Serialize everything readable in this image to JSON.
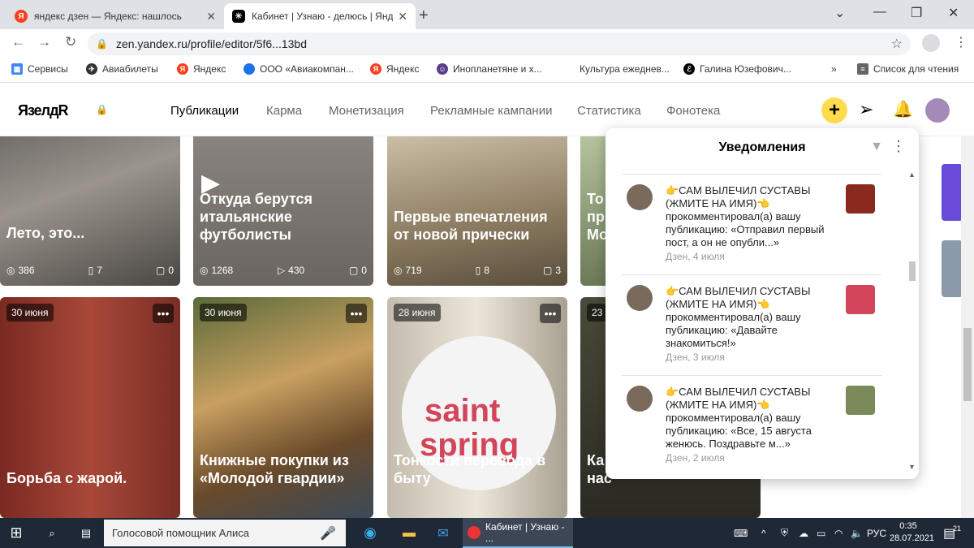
{
  "browser": {
    "tabs": [
      {
        "title": "яндекс дзен — Яндекс: нашлось",
        "favicon": "yandex-icon",
        "active": false
      },
      {
        "title": "Кабинет | Узнаю - делюсь | Янд",
        "favicon": "dzen-icon",
        "active": true
      }
    ],
    "new_tab": "+",
    "url": "zen.yandex.ru/profile/editor/5f6...13bd",
    "bookmarks": [
      {
        "label": "Сервисы",
        "icon": "apps-grid-icon",
        "color": "#4285f4"
      },
      {
        "label": "Авиабилеты",
        "icon": "airplane-icon",
        "color": "#333333"
      },
      {
        "label": "Яндекс",
        "icon": "yandex-icon",
        "color": "#fc3f1d"
      },
      {
        "label": "ООО «Авиакомпан...",
        "icon": "circle-icon",
        "color": "#1a73e8"
      },
      {
        "label": "Яндекс",
        "icon": "yandex-icon",
        "color": "#fc3f1d"
      },
      {
        "label": "Инопланетяне и х...",
        "icon": "person-icon",
        "color": "#5b3e8a"
      },
      {
        "label": "Культура ежеднев...",
        "icon": "none",
        "color": "#ffffff"
      },
      {
        "label": "Галина Юзефович...",
        "icon": "script-e-icon",
        "color": "#000000"
      }
    ],
    "bookmarks_overflow": "»",
    "reading_list": "Список для чтения"
  },
  "header": {
    "logo": "ЯзелдR",
    "nav": [
      "Публикации",
      "Карма",
      "Монетизация",
      "Рекламные кампании",
      "Статистика",
      "Фонотека"
    ],
    "active_nav": "Публикации",
    "accent_color": "#ffdb4d"
  },
  "cards_top": [
    {
      "title": "Лето, это...",
      "views": "386",
      "reads": "7",
      "comments": "0"
    },
    {
      "title": "Откуда берутся итальянские футболисты",
      "views": "1268",
      "plays": "430",
      "comments": "0"
    },
    {
      "title": "Первые впечатления от новой прически",
      "views": "719",
      "reads": "8",
      "comments": "3"
    },
    {
      "title": "То пр Мо",
      "views": ""
    }
  ],
  "cards_bottom": [
    {
      "date": "30 июня",
      "title": "Борьба с жарой."
    },
    {
      "date": "30 июня",
      "title": "Книжные покупки из «Молодой гвардии»"
    },
    {
      "date": "28 июня",
      "title": "Тонкости перевода в быту"
    },
    {
      "date": "23",
      "title": "Ка нас"
    }
  ],
  "saint_spring": {
    "line1": "saint",
    "line2": "spring"
  },
  "notifications": {
    "title": "Уведомления",
    "items": [
      {
        "author": "👉САМ ВЫЛЕЧИЛ СУСТАВЫ (ЖМИТЕ НА ИМЯ)👈",
        "text": "прокомментировал(а) вашу публикацию: «Отправил первый пост, а он не опубли...»",
        "date": "Дзен, 4 июля",
        "thumb_color": "#8a2a1e"
      },
      {
        "author": "👉САМ ВЫЛЕЧИЛ СУСТАВЫ (ЖМИТЕ НА ИМЯ)👈",
        "text": "прокомментировал(а) вашу публикацию: «Давайте знакомиться!»",
        "date": "Дзен, 3 июля",
        "thumb_color": "#d2455a"
      },
      {
        "author": "👉САМ ВЫЛЕЧИЛ СУСТАВЫ (ЖМИТЕ НА ИМЯ)👈",
        "text": "прокомментировал(а) вашу публикацию: «Все, 15 августа женюсь. Поздравьте м...»",
        "date": "Дзен, 2 июля",
        "thumb_color": "#7a8a5a"
      }
    ]
  },
  "taskbar": {
    "search_placeholder": "Голосовой помощник Алиса",
    "active_app": "Кабинет | Узнаю - ...",
    "lang": "РУС",
    "time": "0:35",
    "date": "28.07.2021",
    "notif_count": "21"
  }
}
